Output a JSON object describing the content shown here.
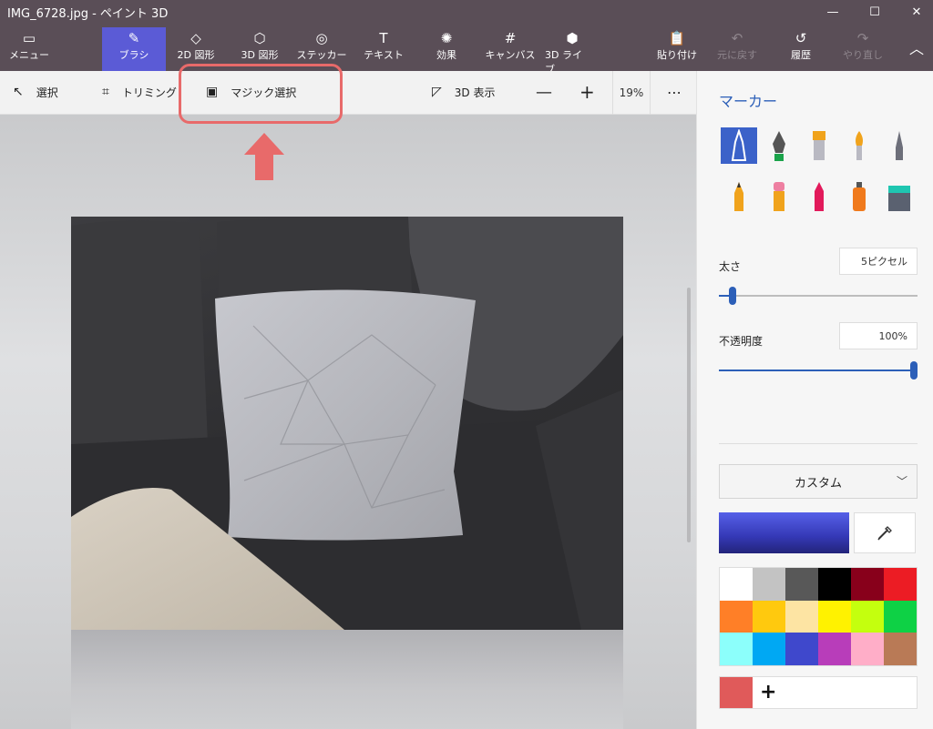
{
  "window": {
    "title": "IMG_6728.jpg - ペイント 3D",
    "controls": [
      "minimize-icon",
      "maximize-icon",
      "close-icon"
    ]
  },
  "ribbon": {
    "tabs": [
      {
        "label": "メニュー",
        "icon": "folder-icon"
      },
      {
        "label": "ブラシ",
        "icon": "brush-icon",
        "active": true
      },
      {
        "label": "2D 図形",
        "icon": "2d-shapes-icon"
      },
      {
        "label": "3D 図形",
        "icon": "3d-shapes-icon"
      },
      {
        "label": "ステッカー",
        "icon": "sticker-icon"
      },
      {
        "label": "テキスト",
        "icon": "text-icon"
      },
      {
        "label": "効果",
        "icon": "effects-icon"
      },
      {
        "label": "キャンバス",
        "icon": "canvas-icon"
      },
      {
        "label": "3D ライブ...",
        "icon": "3d-library-icon"
      }
    ],
    "actions": [
      {
        "label": "貼り付け",
        "icon": "paste-icon"
      },
      {
        "label": "元に戻す",
        "icon": "undo-icon",
        "disabled": true
      },
      {
        "label": "履歴",
        "icon": "history-icon"
      },
      {
        "label": "やり直し",
        "icon": "redo-icon",
        "disabled": true
      }
    ]
  },
  "toolbar": {
    "select": "選択",
    "crop": "トリミング",
    "magic_select": "マジック選択",
    "view3d": "3D 表示",
    "zoom": "19%",
    "more": "⋯"
  },
  "panel": {
    "heading": "マーカー",
    "brushes": [
      "marker-icon",
      "calligraphy-pen-icon",
      "oil-brush-icon",
      "watercolor-icon",
      "pixel-pen-icon",
      "pencil-icon",
      "eraser-icon",
      "crayon-icon",
      "spray-can-icon",
      "fill-bucket-icon"
    ],
    "thickness_label": "太さ",
    "thickness_value": "5ピクセル",
    "thickness_level": 0.05,
    "opacity_label": "不透明度",
    "opacity_value": "100%",
    "opacity_level": 1.0,
    "color_mode": "カスタム",
    "current_color": "#4449c8",
    "palette": [
      "#ffffff",
      "#c3c3c3",
      "#585858",
      "#000000",
      "#88001b",
      "#ec1c24",
      "#ff7f27",
      "#ffc90e",
      "#fde4a3",
      "#fff200",
      "#c4ff0e",
      "#0ed145",
      "#8cfffb",
      "#00a8f3",
      "#3f48cc",
      "#b83dba",
      "#ffaec8",
      "#b97a56"
    ],
    "custom_swatch": "#e05a5a"
  }
}
